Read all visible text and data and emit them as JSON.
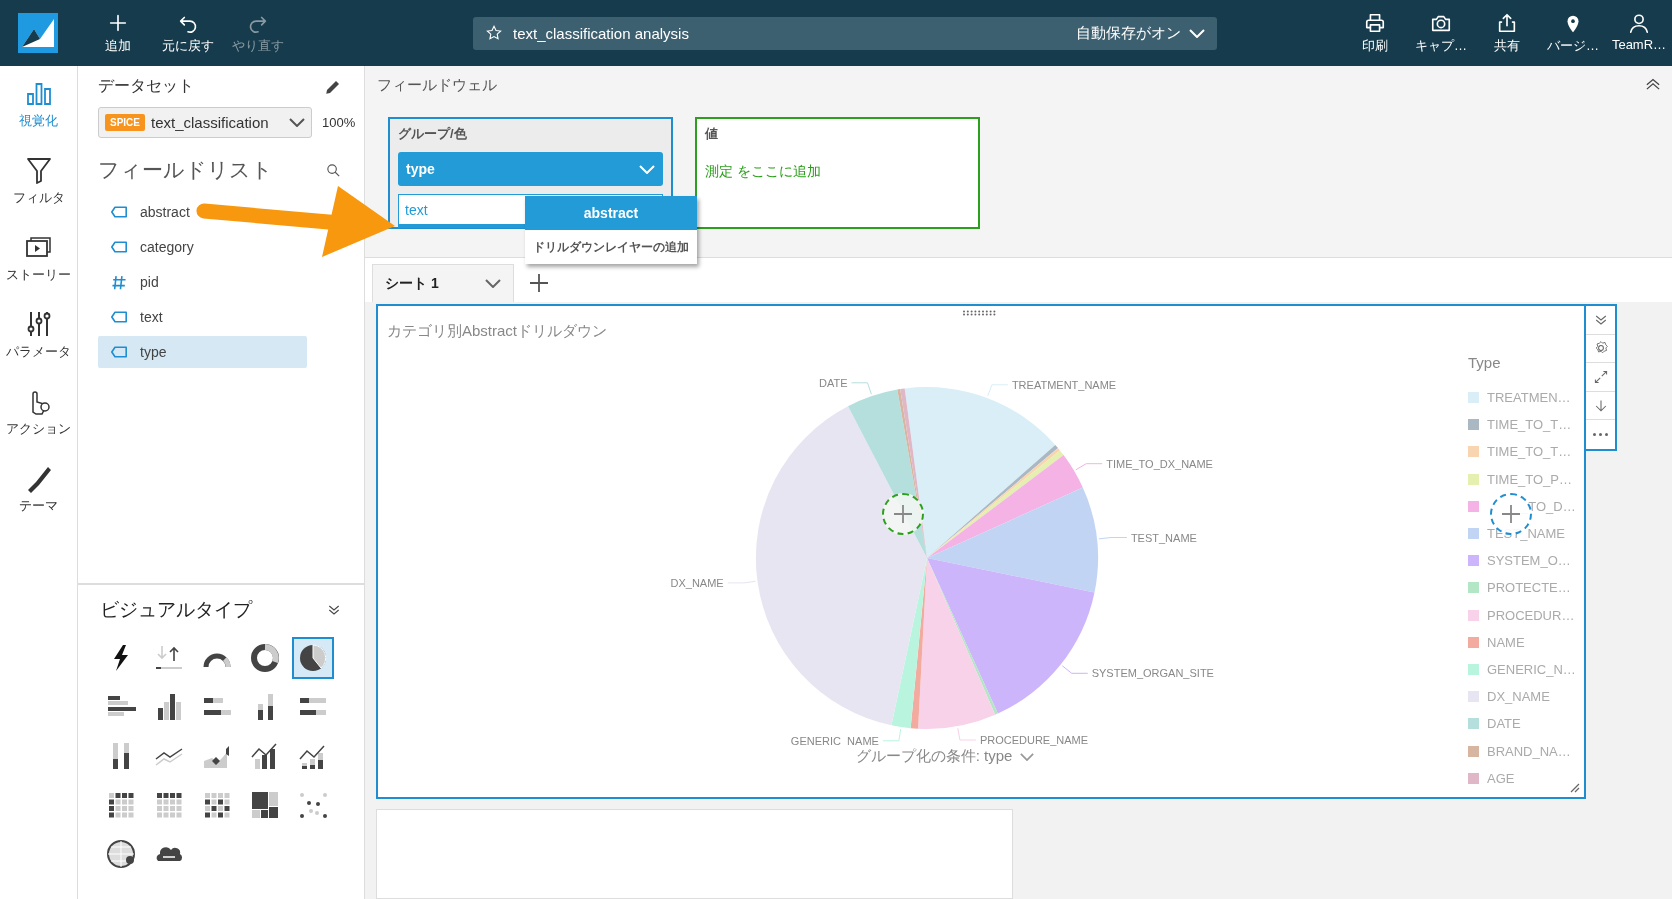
{
  "topbar": {
    "actions": [
      {
        "kind": "add",
        "label": "追加",
        "disabled": false
      },
      {
        "kind": "undo",
        "label": "元に戻す",
        "disabled": false
      },
      {
        "kind": "redo",
        "label": "やり直す",
        "disabled": true
      }
    ],
    "analysis_title": "text_classification analysis",
    "autosave": "自動保存がオン",
    "tools": [
      {
        "kind": "print",
        "label": "印刷"
      },
      {
        "kind": "camera",
        "label": "キャプ…"
      },
      {
        "kind": "share",
        "label": "共有"
      },
      {
        "kind": "pin",
        "label": "バージ…"
      },
      {
        "kind": "user",
        "label": "TeamR…"
      }
    ]
  },
  "nav": [
    {
      "kind": "visualize",
      "label": "視覚化",
      "selected": true
    },
    {
      "kind": "filter",
      "label": "フィルタ",
      "selected": false
    },
    {
      "kind": "story",
      "label": "ストーリー",
      "selected": false
    },
    {
      "kind": "parameter",
      "label": "パラメータ",
      "selected": false
    },
    {
      "kind": "action",
      "label": "アクション",
      "selected": false
    },
    {
      "kind": "theme",
      "label": "テーマ",
      "selected": false
    }
  ],
  "dataset_panel": {
    "title": "データセット",
    "spice_badge": "SPICE",
    "dataset": "text_classification",
    "spice_usage": "100%",
    "field_list_title": "フィールドリスト",
    "fields": [
      {
        "name": "abstract",
        "kind": "dimension",
        "selected": false
      },
      {
        "name": "category",
        "kind": "dimension",
        "selected": false
      },
      {
        "name": "pid",
        "kind": "measure",
        "selected": false
      },
      {
        "name": "text",
        "kind": "dimension",
        "selected": false
      },
      {
        "name": "type",
        "kind": "dimension",
        "selected": true
      }
    ]
  },
  "visual_types": {
    "title": "ビジュアルタイプ",
    "items": [
      {
        "kind": "kpi",
        "selected": false
      },
      {
        "kind": "growth",
        "selected": false
      },
      {
        "kind": "gauge",
        "selected": false
      },
      {
        "kind": "donut",
        "selected": false
      },
      {
        "kind": "pie",
        "selected": true
      },
      {
        "kind": "hbar",
        "selected": false
      },
      {
        "kind": "vbar",
        "selected": false
      },
      {
        "kind": "hbar_stacked",
        "selected": false
      },
      {
        "kind": "vbar_stacked",
        "selected": false
      },
      {
        "kind": "hbar_stacked100",
        "selected": false
      },
      {
        "kind": "vbar_stacked100",
        "selected": false
      },
      {
        "kind": "line",
        "selected": false
      },
      {
        "kind": "area",
        "selected": false
      },
      {
        "kind": "combo_bar",
        "selected": false
      },
      {
        "kind": "combo_stacked",
        "selected": false
      },
      {
        "kind": "pivot",
        "selected": false
      },
      {
        "kind": "table",
        "selected": false
      },
      {
        "kind": "heatmap",
        "selected": false
      },
      {
        "kind": "treemap",
        "selected": false
      },
      {
        "kind": "scatter",
        "selected": false
      },
      {
        "kind": "map",
        "selected": false
      },
      {
        "kind": "wordcloud",
        "selected": false
      }
    ]
  },
  "field_wells": {
    "title": "フィールドウェル",
    "group": {
      "label": "グループ/色",
      "field": "type",
      "drilldown_value": "text"
    },
    "value": {
      "label": "値",
      "placeholder": "測定 をここに追加"
    }
  },
  "drilldown_menu": [
    {
      "label": "abstract",
      "selected": true
    },
    {
      "label": "ドリルダウンレイヤーの追加",
      "selected": false
    }
  ],
  "sheets": [
    {
      "label": "シート 1",
      "selected": true
    }
  ],
  "visual": {
    "title": "カテゴリ別Abstractドリルダウン",
    "legend_title": "Type",
    "group_by": "グループ化の条件: type",
    "pie_labels": [
      "DATE",
      "TREATMENT_NAME",
      "TIME_TO_DX_NAME",
      "TEST_NAME",
      "DX_NAME",
      "SYSTEM_ORGAN_SITE",
      "GENERIC_NAME",
      "PROCEDURE_NAME"
    ],
    "legend": [
      {
        "label": "TREATMEN…",
        "color": "#d9eef7"
      },
      {
        "label": "TIME_TO_T…",
        "color": "#a9b8c3"
      },
      {
        "label": "TIME_TO_T…",
        "color": "#f9d4b0"
      },
      {
        "label": "TIME_TO_P…",
        "color": "#e4efb0"
      },
      {
        "label": "_TO_D…",
        "color": "#f4b3e4"
      },
      {
        "label": "TEST_NAME",
        "color": "#c2d4f3"
      },
      {
        "label": "SYSTEM_O…",
        "color": "#cdb5fb"
      },
      {
        "label": "PROTECTE…",
        "color": "#b3e6c4"
      },
      {
        "label": "PROCEDUR…",
        "color": "#f7d2e8"
      },
      {
        "label": "NAME",
        "color": "#f2ab9e"
      },
      {
        "label": "GENERIC_N…",
        "color": "#b9f5de"
      },
      {
        "label": "DX_NAME",
        "color": "#e6e5f1"
      },
      {
        "label": "DATE",
        "color": "#b5dfdd"
      },
      {
        "label": "BRAND_NA…",
        "color": "#d6b6a0"
      },
      {
        "label": "AGE",
        "color": "#dfb7c6"
      }
    ]
  }
}
